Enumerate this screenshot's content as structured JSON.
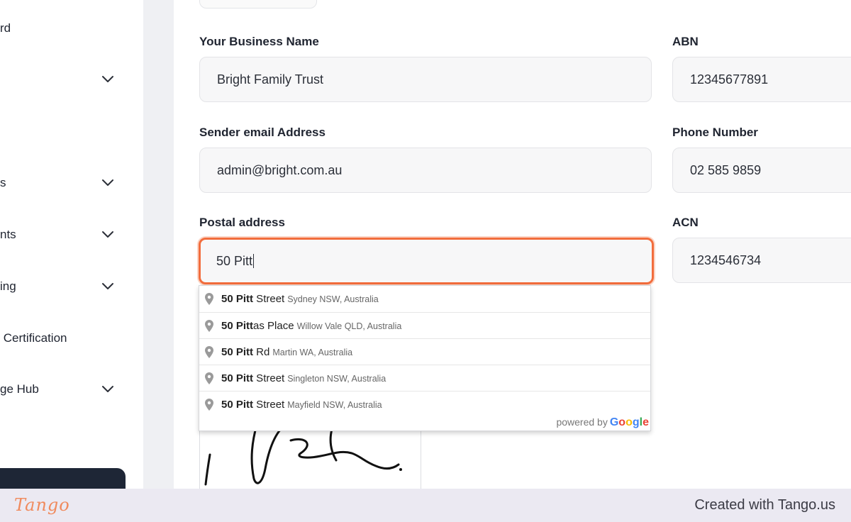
{
  "sidebar": {
    "items": [
      {
        "label": "rd",
        "has_chevron": false
      },
      {
        "label": "",
        "has_chevron": true
      },
      {
        "label": "s",
        "has_chevron": true
      },
      {
        "label": "nts",
        "has_chevron": true
      },
      {
        "label": "ing",
        "has_chevron": true
      },
      {
        "label": " Certification",
        "has_chevron": false
      },
      {
        "label": "ge Hub",
        "has_chevron": true
      }
    ]
  },
  "form": {
    "business_name": {
      "label": "Your Business Name",
      "value": "Bright Family Trust"
    },
    "abn": {
      "label": "ABN",
      "value": "12345677891"
    },
    "sender_email": {
      "label": "Sender email Address",
      "value": "admin@bright.com.au"
    },
    "phone": {
      "label": "Phone Number",
      "value": "02 585 9859"
    },
    "postal_address": {
      "label": "Postal address",
      "value": "50 Pitt"
    },
    "acn": {
      "label": "ACN",
      "value": "1234546734"
    }
  },
  "autocomplete": {
    "suggestions": [
      {
        "match": "50 Pitt",
        "rest": " Street",
        "secondary": "Sydney NSW, Australia"
      },
      {
        "match": "50 Pitt",
        "rest": "as Place",
        "secondary": "Willow Vale QLD, Australia"
      },
      {
        "match": "50 Pitt",
        "rest": " Rd",
        "secondary": "Martin WA, Australia"
      },
      {
        "match": "50 Pitt",
        "rest": " Street",
        "secondary": "Singleton NSW, Australia"
      },
      {
        "match": "50 Pitt",
        "rest": " Street",
        "secondary": "Mayfield NSW, Australia"
      }
    ],
    "powered_by": "powered by",
    "google": "Google"
  },
  "footer": {
    "logo": "Tango",
    "credit": "Created with Tango.us"
  },
  "colors": {
    "focus_border": "#f26d3d",
    "brand_orange": "#f08a5d",
    "sidebar_dark": "#1e2636",
    "google_blue": "#4285F4",
    "google_red": "#EA4335",
    "google_yellow": "#FBBC05",
    "google_green": "#34A853"
  },
  "icons": {
    "chevron": "chevron-down-icon",
    "pin": "map-pin-icon",
    "signature": "signature-drawing"
  }
}
